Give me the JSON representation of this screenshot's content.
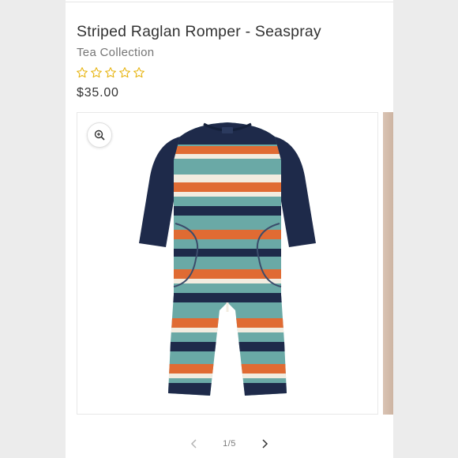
{
  "product": {
    "title": "Striped Raglan Romper - Seaspray",
    "brand": "Tea Collection",
    "rating_stars": 5,
    "rating_value": 0,
    "price": "$35.00"
  },
  "gallery": {
    "current": "1",
    "separator": "/",
    "total": "5"
  },
  "colors": {
    "star_outline": "#e7b30c",
    "navy": "#1e2a4a",
    "teal": "#6aa9a6",
    "orange": "#e06b33",
    "cream": "#f2ece0"
  },
  "icons": {
    "zoom": "zoom-in-icon",
    "star": "star-outline-icon",
    "prev": "chevron-left-icon",
    "next": "chevron-right-icon"
  }
}
